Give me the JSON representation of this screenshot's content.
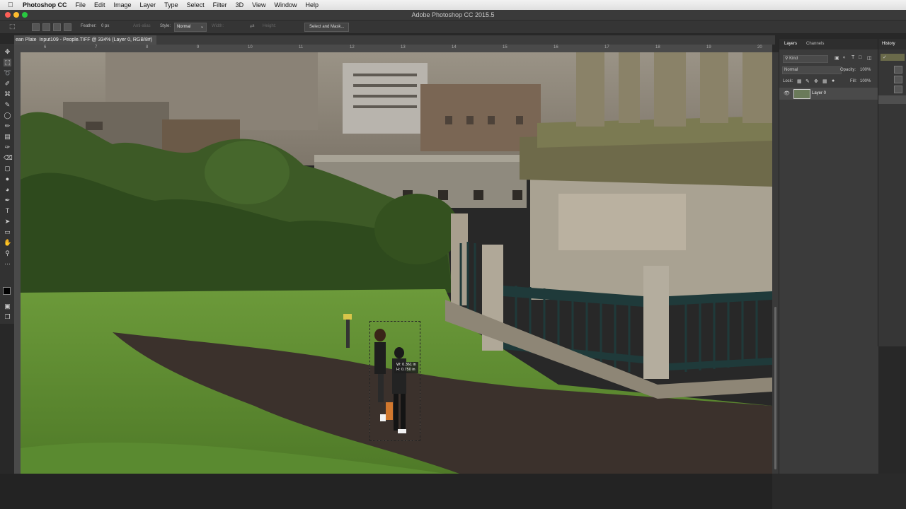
{
  "menubar": {
    "app_name": "Photoshop CC",
    "items": [
      "File",
      "Edit",
      "Image",
      "Layer",
      "Type",
      "Select",
      "Filter",
      "3D",
      "View",
      "Window",
      "Help"
    ]
  },
  "window": {
    "title": "Adobe Photoshop CC 2015.5"
  },
  "options_bar": {
    "feather_label": "Feather:",
    "feather_value": "0 px",
    "antialias_label": "Anti-alias",
    "style_label": "Style:",
    "style_value": "Normal",
    "width_label": "Width:",
    "height_label": "Height:",
    "select_mask_label": "Select and Mask..."
  },
  "document": {
    "tab_prefix": "ean Plate",
    "tab_title": "Input109 - People.TIFF @ 334% (Layer 0, RGB/8#)"
  },
  "ruler": {
    "ticks": [
      "6",
      "7",
      "8",
      "9",
      "10",
      "11",
      "12",
      "13",
      "14",
      "15",
      "16",
      "17",
      "18",
      "19",
      "20"
    ]
  },
  "selection_tip": {
    "w": "W: 0.361 in",
    "h": "H: 0.750 in"
  },
  "layers_panel": {
    "tabs": [
      "Layers",
      "Channels"
    ],
    "filter_label": "Kind",
    "blend_mode": "Normal",
    "opacity_label": "Opacity:",
    "opacity_value": "100%",
    "lock_label": "Lock:",
    "fill_label": "Fill:",
    "fill_value": "100%",
    "layers": [
      {
        "name": "Layer 0",
        "visible": true
      }
    ]
  },
  "history_panel": {
    "title": "History"
  },
  "colors": {
    "ui_dark": "#282828",
    "panel": "#3b3b3b",
    "grass": "#5f8a33",
    "path": "#3b312c"
  }
}
